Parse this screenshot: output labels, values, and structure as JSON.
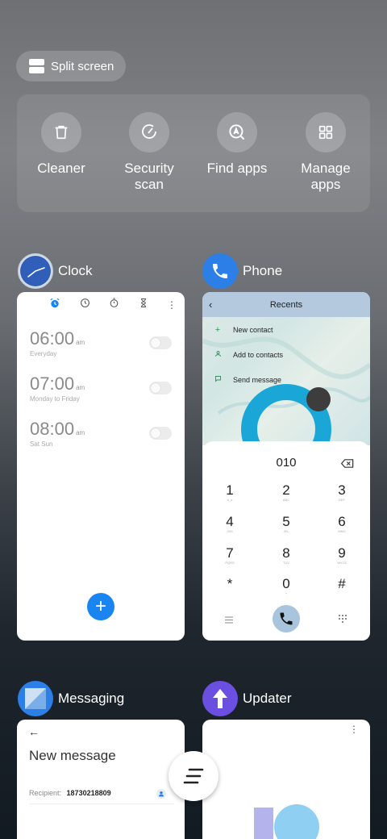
{
  "split_screen": {
    "label": "Split screen"
  },
  "tools": [
    {
      "label_1": "Cleaner",
      "label_2": "",
      "icon": "trash-icon"
    },
    {
      "label_1": "Security",
      "label_2": "scan",
      "icon": "security-scan-icon"
    },
    {
      "label_1": "Find apps",
      "label_2": "",
      "icon": "find-apps-icon"
    },
    {
      "label_1": "Manage",
      "label_2": "apps",
      "icon": "grid-icon"
    }
  ],
  "apps": {
    "clock": {
      "name": "Clock",
      "alarms": [
        {
          "time": "06:00",
          "ampm": "am",
          "days": "Everyday"
        },
        {
          "time": "07:00",
          "ampm": "am",
          "days": "Monday to Friday"
        },
        {
          "time": "08:00",
          "ampm": "am",
          "days": "Sat Sun"
        }
      ],
      "fab": "+"
    },
    "phone": {
      "name": "Phone",
      "title": "Recents",
      "actions": [
        "New contact",
        "Add to contacts",
        "Send message"
      ],
      "number": "010",
      "keys": [
        {
          "d": "1",
          "s": "o_o"
        },
        {
          "d": "2",
          "s": "ABC"
        },
        {
          "d": "3",
          "s": "DEF"
        },
        {
          "d": "4",
          "s": "GHI"
        },
        {
          "d": "5",
          "s": "JKL"
        },
        {
          "d": "6",
          "s": "MNO"
        },
        {
          "d": "7",
          "s": "PQRS"
        },
        {
          "d": "8",
          "s": "TUV"
        },
        {
          "d": "9",
          "s": "WXYZ"
        },
        {
          "d": "*",
          "s": ""
        },
        {
          "d": "0",
          "s": "+"
        },
        {
          "d": "#",
          "s": ""
        }
      ]
    },
    "messaging": {
      "name": "Messaging",
      "title": "New message",
      "recipient_label": "Recipient:",
      "recipient_value": "18730218809"
    },
    "updater": {
      "name": "Updater"
    }
  },
  "colors": {
    "accent_blue": "#1a85f0",
    "phone_bar": "#b4c9de",
    "call_button": "#a8c5dd"
  }
}
